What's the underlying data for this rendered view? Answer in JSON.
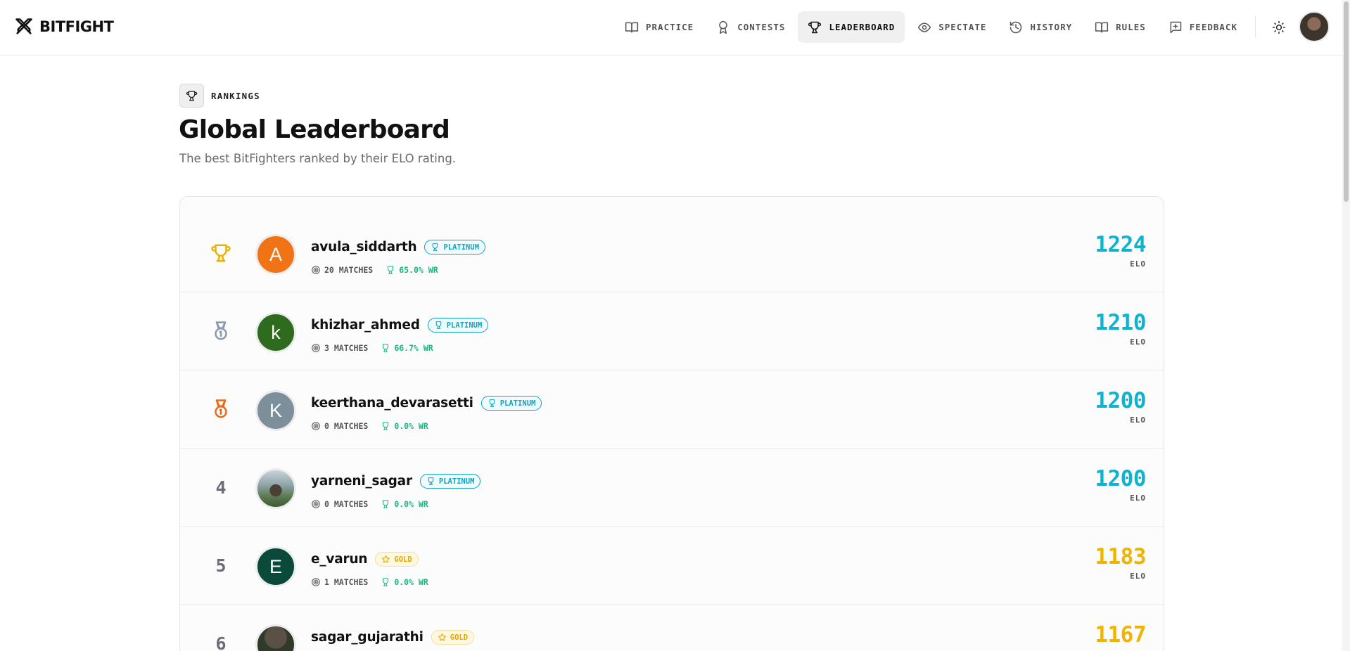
{
  "app": {
    "name": "BITFIGHT"
  },
  "nav": {
    "items": [
      {
        "label": "PRACTICE",
        "icon": "book-icon"
      },
      {
        "label": "CONTESTS",
        "icon": "award-icon"
      },
      {
        "label": "LEADERBOARD",
        "icon": "trophy-icon",
        "active": true
      },
      {
        "label": "SPECTATE",
        "icon": "eye-icon"
      },
      {
        "label": "HISTORY",
        "icon": "history-icon"
      },
      {
        "label": "RULES",
        "icon": "book-open-icon"
      },
      {
        "label": "FEEDBACK",
        "icon": "message-plus-icon"
      }
    ]
  },
  "page": {
    "badge": "RANKINGS",
    "title": "Global Leaderboard",
    "subtitle": "The best BitFighters ranked by their ELO rating."
  },
  "colors": {
    "platinum": "#0fb3d1",
    "gold": "#f0b400",
    "win_rate": "#12b981",
    "rank1": "#eab308",
    "rank2": "#8a9bb0",
    "rank3": "#ea6a1a"
  },
  "leaderboard": {
    "elo_label": "ELO",
    "rows": [
      {
        "rank": "1",
        "rank_icon": "trophy-icon",
        "username": "avula_siddarth",
        "initial": "A",
        "avatar_color": "#f07316",
        "tier": "PLATINUM",
        "matches": "20 MATCHES",
        "win_rate": "65.0% WR",
        "elo": "1224"
      },
      {
        "rank": "2",
        "rank_icon": "medal-silver-icon",
        "username": "khizhar_ahmed",
        "initial": "k",
        "avatar_color": "#2f6b1f",
        "tier": "PLATINUM",
        "matches": "3 MATCHES",
        "win_rate": "66.7% WR",
        "elo": "1210"
      },
      {
        "rank": "3",
        "rank_icon": "medal-bronze-icon",
        "username": "keerthana_devarasetti",
        "initial": "K",
        "avatar_color": "#7d8f9b",
        "tier": "PLATINUM",
        "matches": "0 MATCHES",
        "win_rate": "0.0% WR",
        "elo": "1200"
      },
      {
        "rank": "4",
        "username": "yarneni_sagar",
        "tier": "PLATINUM",
        "matches": "0 MATCHES",
        "win_rate": "0.0% WR",
        "elo": "1200"
      },
      {
        "rank": "5",
        "username": "e_varun",
        "initial": "E",
        "avatar_color": "#0b4a3a",
        "tier": "GOLD",
        "matches": "1 MATCHES",
        "win_rate": "0.0% WR",
        "elo": "1183"
      },
      {
        "rank": "6",
        "username": "sagar_gujarathi",
        "tier": "GOLD",
        "elo": "1167"
      }
    ]
  }
}
